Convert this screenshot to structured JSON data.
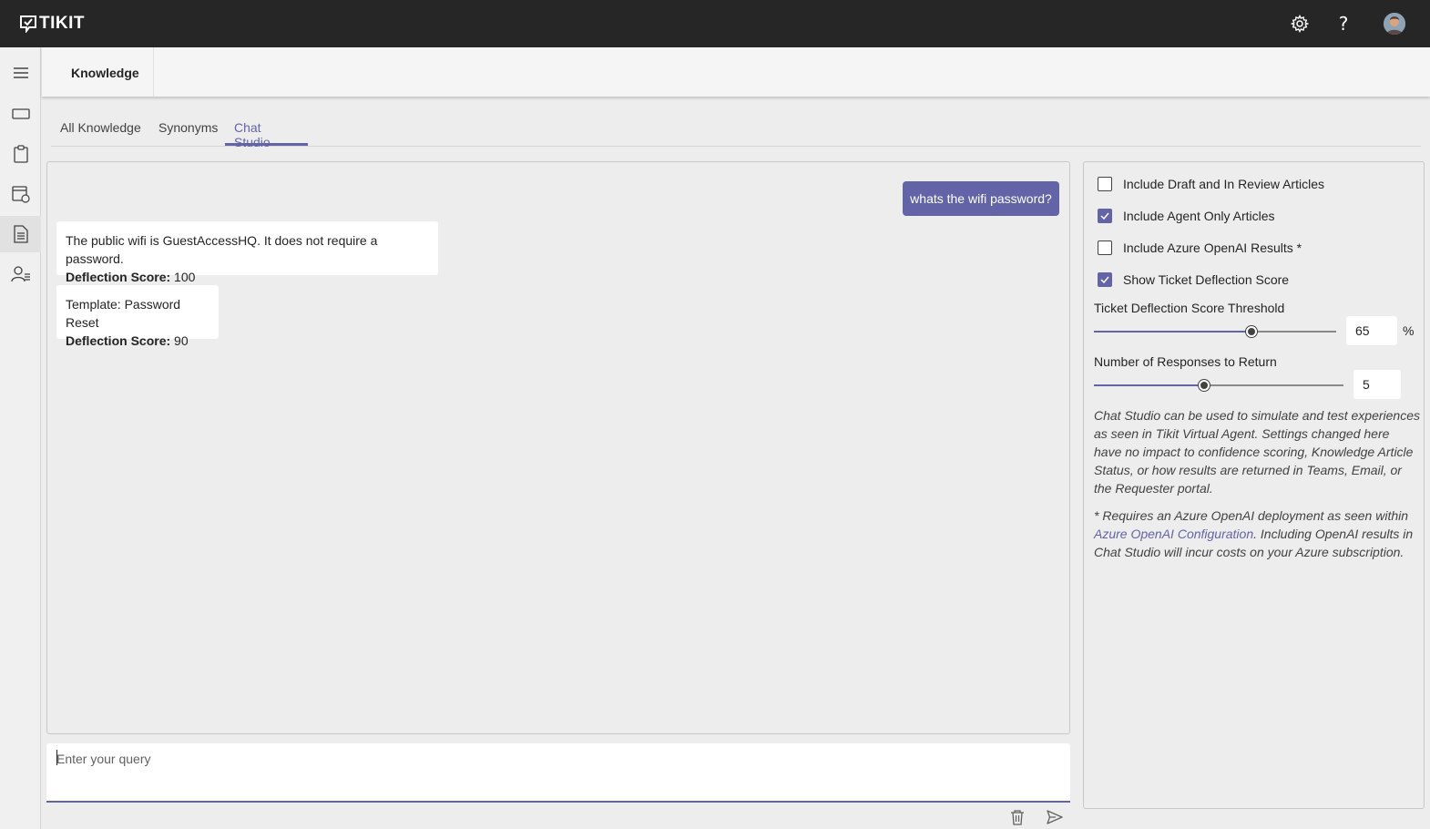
{
  "app": {
    "logo_text": "TIKIT"
  },
  "header": {
    "settings_icon": "gear-icon",
    "help_label": "?",
    "avatar_icon": "avatar"
  },
  "sidebar": {
    "items": [
      {
        "icon": "hamburger-menu-icon",
        "active": false
      },
      {
        "icon": "ticket-icon",
        "active": false
      },
      {
        "icon": "clipboard-icon",
        "active": false
      },
      {
        "icon": "calendar-list-icon",
        "active": false
      },
      {
        "icon": "document-icon",
        "active": true
      },
      {
        "icon": "people-list-icon",
        "active": false
      }
    ]
  },
  "page": {
    "title": "Knowledge"
  },
  "tabs": [
    {
      "label": "All Knowledge",
      "active": false
    },
    {
      "label": "Synonyms",
      "active": false
    },
    {
      "label": "Chat Studio",
      "active": true
    }
  ],
  "chat": {
    "user_message": "whats the wifi password?",
    "responses": [
      {
        "text": "The public wifi is GuestAccessHQ. It does not require a password.",
        "score_label": "Deflection Score:",
        "score": "100"
      },
      {
        "text": "Template: Password Reset",
        "score_label": "Deflection Score:",
        "score": "90"
      }
    ],
    "query_placeholder": "Enter your query",
    "delete_icon": "trash-icon",
    "send_icon": "send-icon"
  },
  "settings": {
    "checkboxes": [
      {
        "label": "Include Draft and In Review Articles",
        "checked": false
      },
      {
        "label": "Include Agent Only Articles",
        "checked": true
      },
      {
        "label": "Include Azure OpenAI Results *",
        "checked": false
      },
      {
        "label": "Show Ticket Deflection Score",
        "checked": true
      }
    ],
    "threshold": {
      "label": "Ticket Deflection Score Threshold",
      "value": "65",
      "unit": "%",
      "level": 0.65
    },
    "responses": {
      "label": "Number of Responses to Return",
      "value": "5",
      "level": 0.44
    },
    "description": "Chat Studio can be used to simulate and test experiences as seen in Tikit Virtual Agent. Settings changed here have no impact to confidence scoring, Knowledge Article Status, or how results are returned in Teams, Email, or the Requester portal.",
    "note_prefix": "* Requires an Azure OpenAI deployment as seen within ",
    "note_link": "Azure OpenAI Configuration",
    "note_suffix": ". Including OpenAI results in Chat Studio will incur costs on your Azure subscription."
  },
  "colors": {
    "accent": "#6264a7",
    "topbar": "#262626",
    "background": "#ededed"
  }
}
